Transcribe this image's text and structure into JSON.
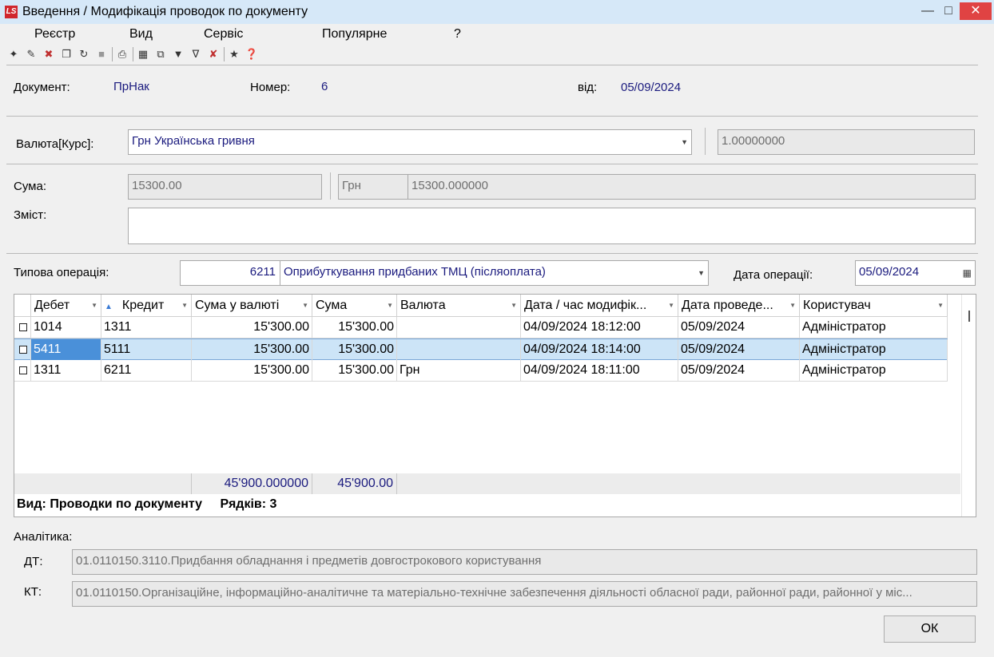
{
  "window": {
    "title": "Введення / Модифікація проводок по документу",
    "logo": "LS"
  },
  "menu": [
    "Реєстр",
    "Вид",
    "Сервіс",
    "Популярне",
    "?"
  ],
  "document": {
    "label_doc": "Документ:",
    "doc_type": "ПрНак",
    "label_num": "Номер:",
    "number": "6",
    "label_from": "від:",
    "date": "05/09/2024"
  },
  "currency": {
    "label": "Валюта[Курс]:",
    "value": "Грн Українська гривня",
    "rate": "1.00000000"
  },
  "sum": {
    "label": "Сума:",
    "value": "15300.00",
    "currency": "Грн",
    "value_uah": "15300.000000"
  },
  "content": {
    "label": "Зміст:",
    "value": ""
  },
  "operation": {
    "label": "Типова операція:",
    "code": "6211",
    "name": "Оприбуткування придбаних ТМЦ (післяоплата)",
    "date_label": "Дата операції:",
    "date": "05/09/2024"
  },
  "grid": {
    "columns": [
      "Дебет",
      "Кредит",
      "Сума у валюті",
      "Сума",
      "Валюта",
      "Дата / час модифік...",
      "Дата проведе...",
      "Користувач"
    ],
    "rows": [
      {
        "debit": "1014",
        "credit": "1311",
        "sum_cur": "15'300.00",
        "sum": "15'300.00",
        "currency": "",
        "modified": "04/09/2024 18:12:00",
        "posted": "05/09/2024",
        "user": "Адміністратор"
      },
      {
        "debit": "5411",
        "credit": "5111",
        "sum_cur": "15'300.00",
        "sum": "15'300.00",
        "currency": "",
        "modified": "04/09/2024 18:14:00",
        "posted": "05/09/2024",
        "user": "Адміністратор"
      },
      {
        "debit": "1311",
        "credit": "6211",
        "sum_cur": "15'300.00",
        "sum": "15'300.00",
        "currency": "Грн",
        "modified": "04/09/2024 18:11:00",
        "posted": "05/09/2024",
        "user": "Адміністратор"
      }
    ],
    "total_sum_cur": "45'900.000000",
    "total_sum": "45'900.00",
    "view_label": "Вид: Проводки по документу",
    "rows_label": "Рядків: 3"
  },
  "analytics": {
    "label": "Аналітика:",
    "dt_label": "ДТ:",
    "dt_value": "01.0110150.3110.Придбання обладнання і предметів довгострокового користування",
    "kt_label": "КТ:",
    "kt_value": "01.0110150.Організаційне, інформаційно-аналітичне та матеріально-технічне забезпечення діяльності обласної ради, районної ради, районної у міс..."
  },
  "buttons": {
    "ok": "ОК"
  },
  "colors": {
    "accent": "#1a1a7e",
    "selection": "#cce4f7",
    "close": "#e04343"
  }
}
